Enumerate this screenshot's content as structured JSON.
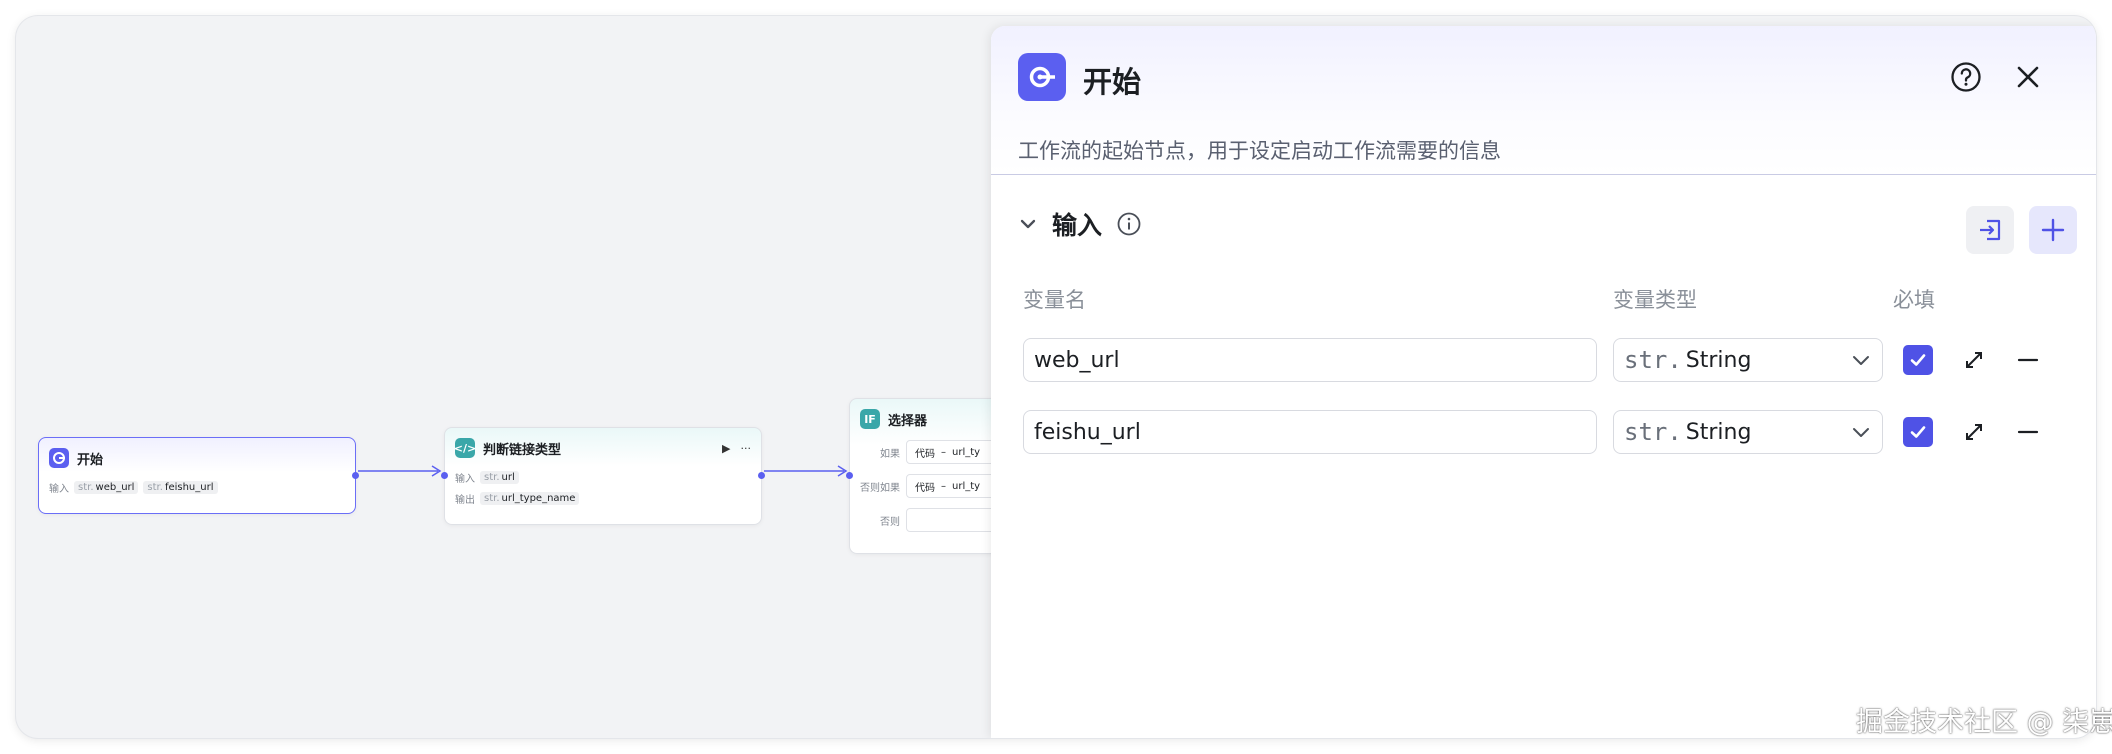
{
  "canvas": {
    "start_node": {
      "title": "开始",
      "input_label": "输入",
      "tags": [
        {
          "prefix": "str.",
          "name": "web_url"
        },
        {
          "prefix": "str.",
          "name": "feishu_url"
        }
      ]
    },
    "judge_node": {
      "title": "判断链接类型",
      "play_icon": "▶",
      "more_icon": "···",
      "input_label": "输入",
      "input_tag": {
        "prefix": "str.",
        "name": "url"
      },
      "output_label": "输出",
      "output_tag": {
        "prefix": "str.",
        "name": "url_type_name"
      }
    },
    "select_node": {
      "title": "选择器",
      "icon_text": "IF",
      "rows": [
        {
          "label": "如果",
          "value": "代码",
          "dash": "–",
          "var": "url_ty"
        },
        {
          "label": "否则如果",
          "value": "代码",
          "dash": "–",
          "var": "url_ty"
        },
        {
          "label": "否则",
          "value": "",
          "dash": "",
          "var": ""
        }
      ]
    }
  },
  "panel": {
    "title": "开始",
    "description": "工作流的起始节点，用于设定启动工作流需要的信息",
    "section_title": "输入",
    "columns": {
      "name": "变量名",
      "type": "变量类型",
      "required": "必填"
    },
    "variables": [
      {
        "name": "web_url",
        "type_prefix": "str.",
        "type": "String",
        "required": true
      },
      {
        "name": "feishu_url",
        "type_prefix": "str.",
        "type": "String",
        "required": true
      }
    ]
  },
  "watermark": "掘金技术社区 @ 柒崽",
  "colors": {
    "accent": "#5b5ff0",
    "teal": "#3aa7a9",
    "checkbox": "#4f52e6"
  }
}
